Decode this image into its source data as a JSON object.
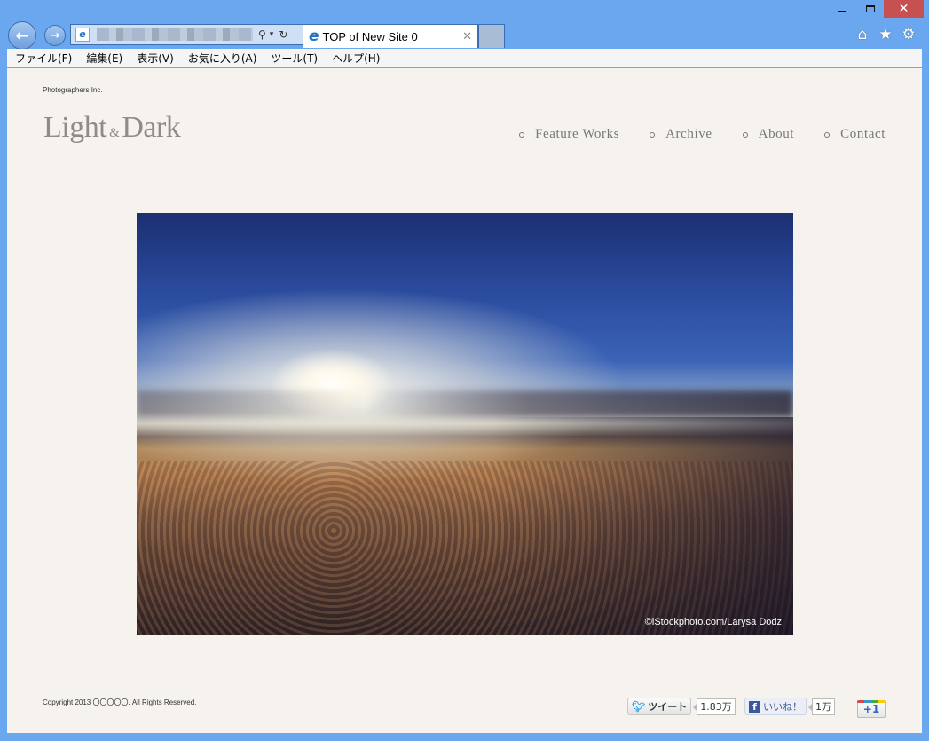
{
  "browser": {
    "tab_title": "TOP of New Site 0",
    "address_url_blurred": true,
    "menu": [
      "ファイル(F)",
      "編集(E)",
      "表示(V)",
      "お気に入り(A)",
      "ツール(T)",
      "ヘルプ(H)"
    ],
    "icons": {
      "back": "←",
      "forward": "→",
      "ie": "e",
      "search": "⚲",
      "dropdown": "▾",
      "refresh": "↻",
      "tab_close": "✕",
      "home": "⌂",
      "favorites": "★",
      "settings": "⚙",
      "window_close": "✕"
    }
  },
  "site": {
    "company": "Photographers Inc.",
    "logo": {
      "word1": "Light",
      "amp": "&",
      "word2": "Dark"
    },
    "nav": [
      {
        "label": "Feature Works"
      },
      {
        "label": "Archive"
      },
      {
        "label": "About"
      },
      {
        "label": "Contact"
      }
    ],
    "hero": {
      "credit": "©iStockphoto.com/Larysa Dodz"
    },
    "copyright": "Copyright 2013 〇〇〇〇〇. All Rights Reserved.",
    "social": {
      "tweet_label": "ツイート",
      "tweet_count": "1.83万",
      "like_label": "いいね！",
      "like_count": "1万",
      "plusone_label": "+1"
    }
  }
}
